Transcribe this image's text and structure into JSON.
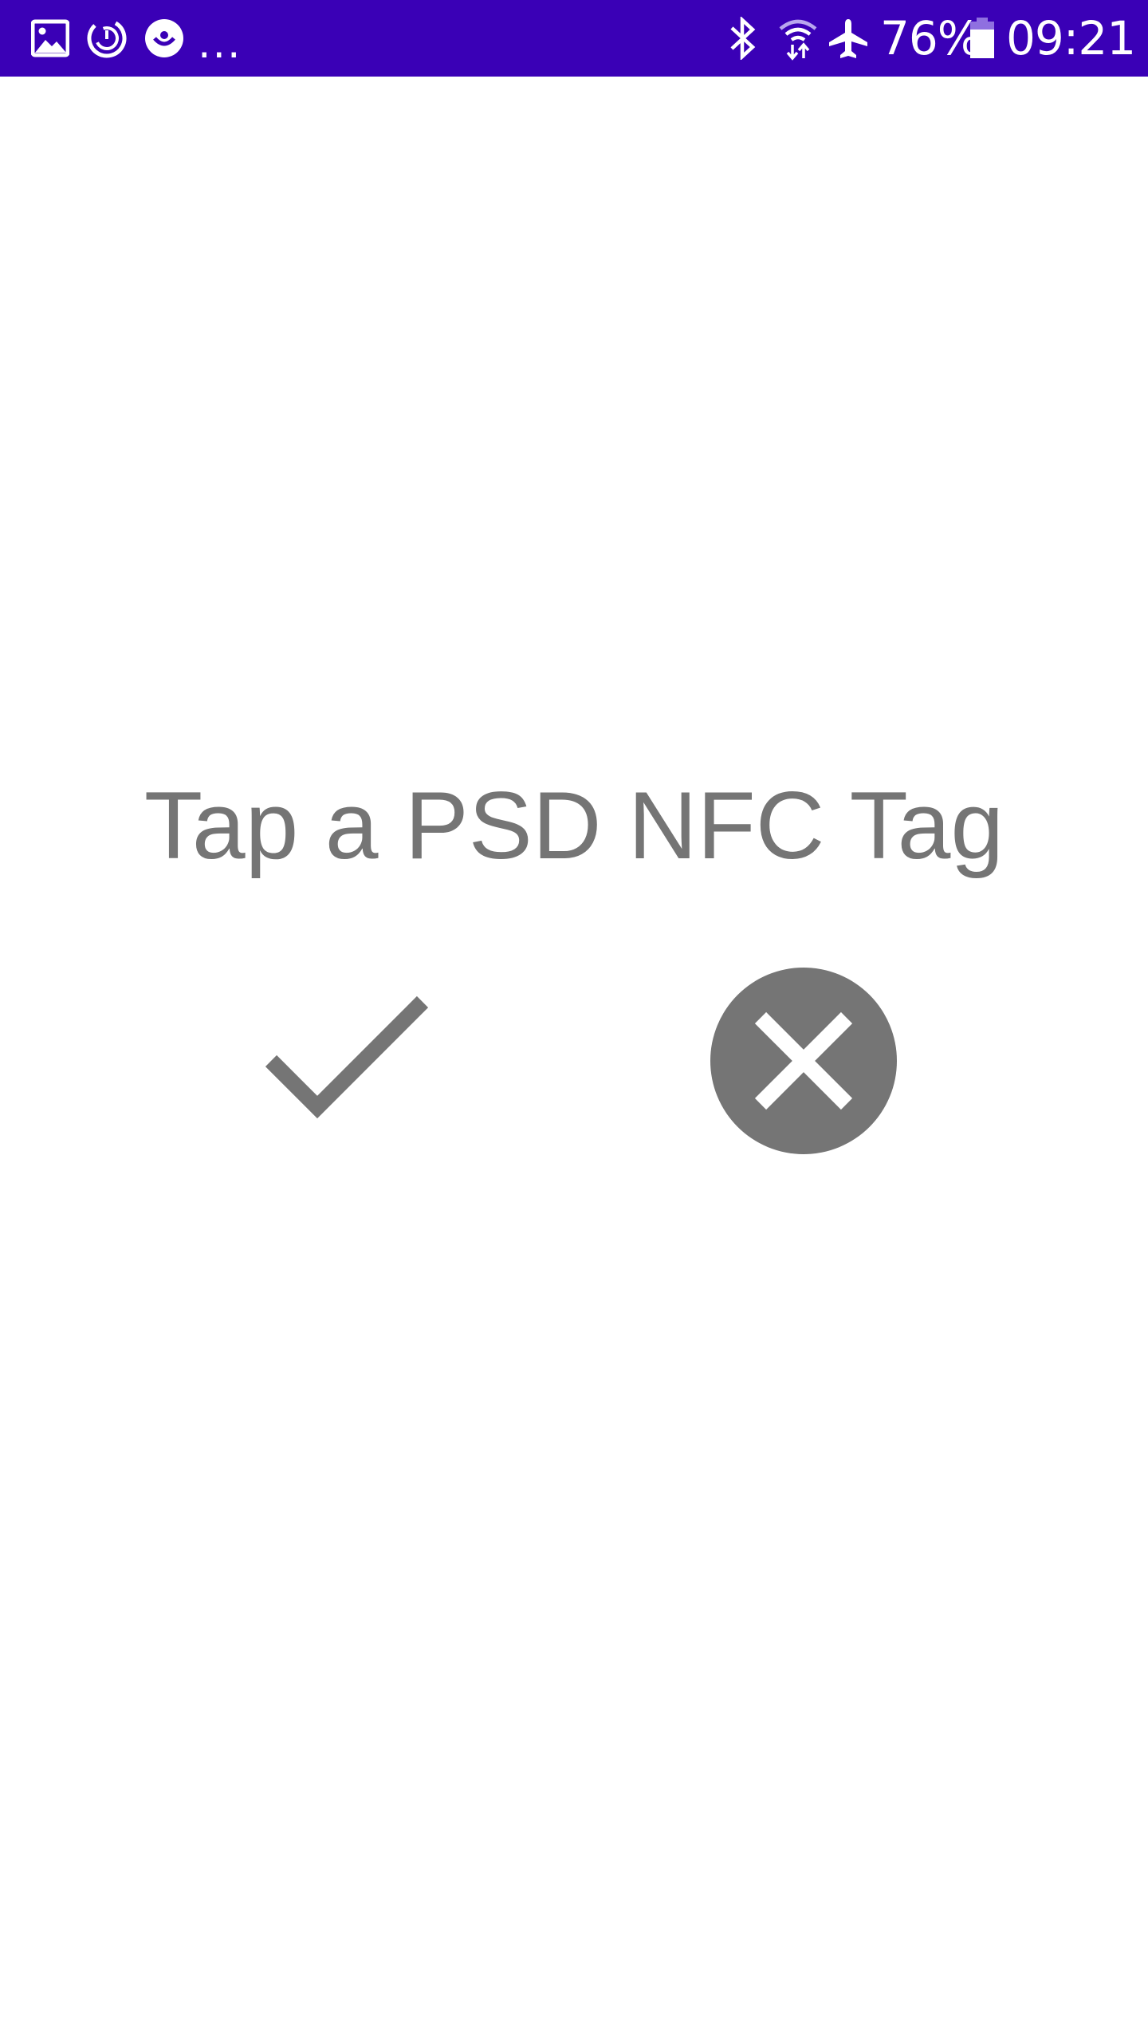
{
  "status_bar": {
    "background": "#3a00b6",
    "left_icons": [
      "gallery-icon",
      "sync-icon",
      "face-icon"
    ],
    "more_indicator": "...",
    "right_icons": [
      "bluetooth-icon",
      "wifi-icon",
      "airplane-icon",
      "battery-icon"
    ],
    "battery": "76%",
    "time": "09:21"
  },
  "main": {
    "prompt": "Tap a PSD NFC Tag",
    "text_color": "#757575",
    "confirm_icon": "checkmark-icon",
    "cancel_icon": "cancel-circle-icon"
  }
}
